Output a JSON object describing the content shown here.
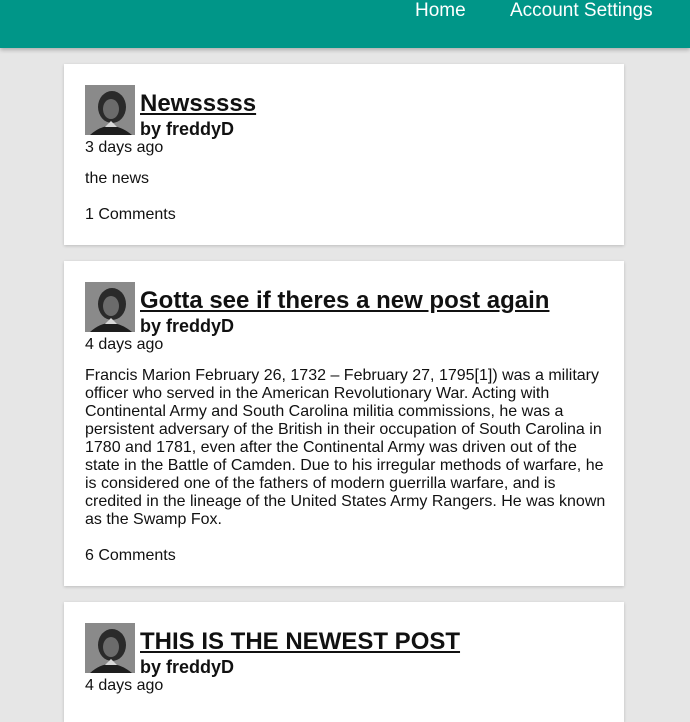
{
  "nav": {
    "home_label": "Home",
    "account_label": "Account Settings"
  },
  "posts": [
    {
      "title": "Newsssss",
      "author": "by freddyD",
      "time": "3 days ago",
      "body": "the news",
      "comments": "1 Comments"
    },
    {
      "title": "Gotta see if theres a new post again",
      "author": "by freddyD",
      "time": "4 days ago",
      "body": "Francis Marion February 26, 1732 – February 27, 1795[1]) was a military officer who served in the American Revolutionary War. Acting with Continental Army and South Carolina militia commissions, he was a persistent adversary of the British in their occupation of South Carolina in 1780 and 1781, even after the Continental Army was driven out of the state in the Battle of Camden. Due to his irregular methods of warfare, he is considered one of the fathers of modern guerrilla warfare, and is credited in the lineage of the United States Army Rangers. He was known as the Swamp Fox.",
      "comments": "6 Comments"
    },
    {
      "title": "THIS IS THE NEWEST POST",
      "author": "by freddyD",
      "time": "4 days ago"
    }
  ],
  "colors": {
    "navbar": "#009688",
    "background": "#e6e6e6"
  }
}
